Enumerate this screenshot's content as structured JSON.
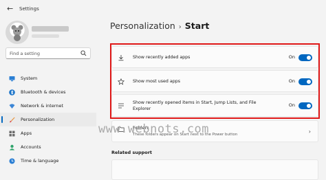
{
  "window": {
    "title": "Settings"
  },
  "user": {
    "name_hidden": true
  },
  "search": {
    "placeholder": "Find a setting"
  },
  "sidebar": {
    "items": [
      {
        "label": "System",
        "icon": "system-icon",
        "active": false
      },
      {
        "label": "Bluetooth & devices",
        "icon": "bluetooth-icon",
        "active": false
      },
      {
        "label": "Network & internet",
        "icon": "network-icon",
        "active": false
      },
      {
        "label": "Personalization",
        "icon": "brush-icon",
        "active": true
      },
      {
        "label": "Apps",
        "icon": "apps-icon",
        "active": false
      },
      {
        "label": "Accounts",
        "icon": "account-icon",
        "active": false
      },
      {
        "label": "Time & language",
        "icon": "time-icon",
        "active": false
      }
    ]
  },
  "header": {
    "parent": "Personalization",
    "separator": "›",
    "current": "Start"
  },
  "settings": [
    {
      "label": "Show recently added apps",
      "state": "On",
      "icon": "download-icon"
    },
    {
      "label": "Show most used apps",
      "state": "On",
      "icon": "star-icon"
    },
    {
      "label": "Show recently opened items in Start, Jump Lists, and File",
      "label2": "Explorer",
      "state": "On",
      "icon": "list-icon"
    }
  ],
  "folders": {
    "label": "Folders",
    "description": "These folders appear on Start next to the Power button",
    "icon": "folder-icon"
  },
  "related": {
    "title": "Related support"
  },
  "watermark": "www.webnots.com",
  "colors": {
    "accent": "#0067c0",
    "highlight": "#e01818"
  }
}
